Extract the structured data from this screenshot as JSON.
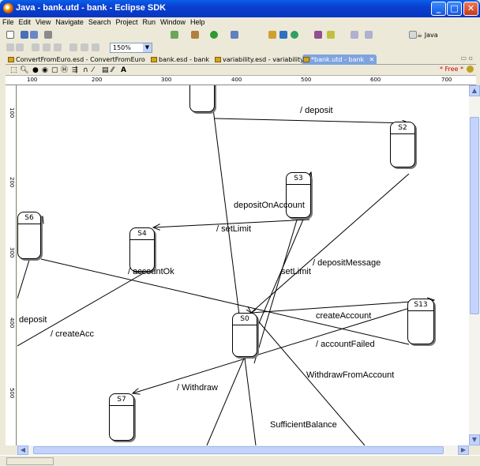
{
  "window": {
    "title": "Java - bank.utd - bank - Eclipse SDK"
  },
  "menu": [
    "File",
    "Edit",
    "View",
    "Navigate",
    "Search",
    "Project",
    "Run",
    "Window",
    "Help"
  ],
  "toolbar": {
    "zoom": "150%",
    "perspective": "Java"
  },
  "tabs": [
    {
      "label": "ConvertFromEuro.esd - ConvertFromEuro",
      "active": false
    },
    {
      "label": "bank.esd - bank",
      "active": false
    },
    {
      "label": "variability.esd - variability",
      "active": false
    },
    {
      "label": "*bank.utd - bank",
      "active": true
    }
  ],
  "palette": {
    "free_label": "* Free *"
  },
  "ruler": {
    "h_ticks": [
      "100",
      "200",
      "300",
      "400",
      "500",
      "600",
      "700"
    ],
    "v_ticks": [
      "100",
      "200",
      "300",
      "400",
      "500"
    ]
  },
  "diagram": {
    "states": [
      "S2",
      "S3",
      "S4",
      "S6",
      "S0",
      "S13",
      "S7"
    ],
    "labels": {
      "deposit_top": "/ deposit",
      "deposit_on_account": "depositOnAccount",
      "set_limit_slash": "/ setLimit",
      "account_ok": "/ accountOk",
      "deposit_message": "/ depositMessage",
      "set_limit": "setLimit",
      "deposit_left": "deposit",
      "create_acc": "/ createAcc",
      "create_account": "createAccount",
      "account_failed": "/ accountFailed",
      "withdraw_from_account": "WithdrawFromAccount",
      "withdraw": "/ Withdraw",
      "sufficient_balance": "SufficientBalance"
    }
  }
}
